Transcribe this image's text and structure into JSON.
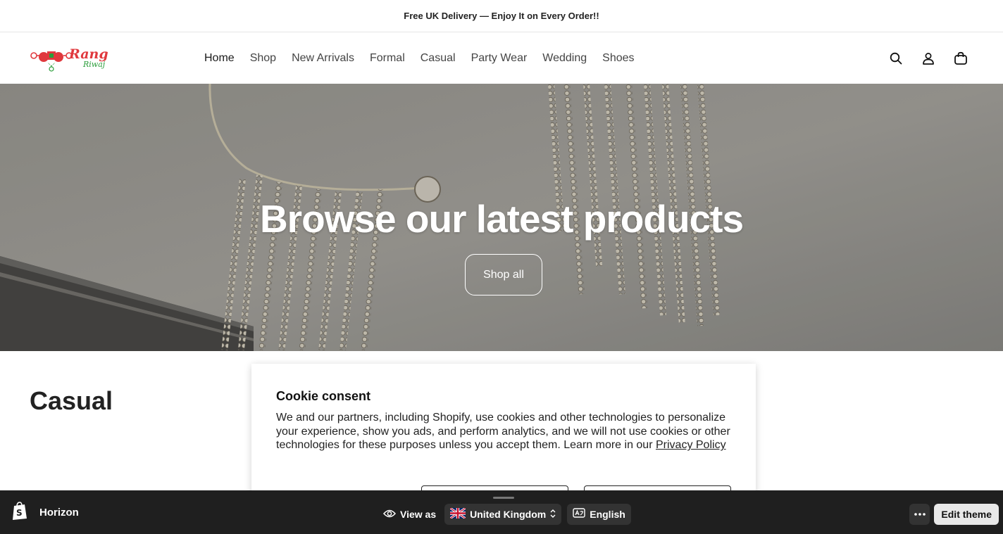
{
  "announcement": "Free UK Delivery — Enjoy It on Every Order!!",
  "logo": {
    "brand_top": "Rang",
    "brand_bottom": "Riwaj"
  },
  "nav": {
    "items": [
      "Home",
      "Shop",
      "New Arrivals",
      "Formal",
      "Casual",
      "Party Wear",
      "Wedding",
      "Shoes"
    ],
    "active": "Home"
  },
  "header_icons": [
    "search-icon",
    "account-icon",
    "cart-icon"
  ],
  "hero": {
    "title": "Browse our latest products",
    "button": "Shop all"
  },
  "section": {
    "title": "Casual"
  },
  "cookie": {
    "title": "Cookie consent",
    "body": "We and our partners, including Shopify, use cookies and other technologies to personalize your experience, show you ads, and perform analytics, and we will not use cookies or other technologies for these purposes unless you accept them. Learn more in our ",
    "link": "Privacy Policy"
  },
  "preview_bar": {
    "theme": "Horizon",
    "view_as": "View as",
    "country": "United Kingdom",
    "language": "English",
    "edit": "Edit theme"
  },
  "colors": {
    "logo_red": "#e0393e",
    "logo_green": "#2a9d3a",
    "bar_bg": "#1f1f1f"
  }
}
